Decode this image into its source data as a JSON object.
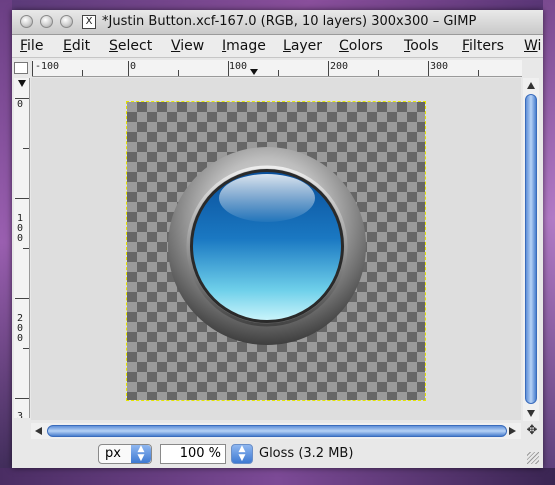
{
  "window": {
    "title": "*Justin Button.xcf-167.0 (RGB, 10 layers) 300x300 – GIMP",
    "x11_icon": "X"
  },
  "menu": [
    "File",
    "Edit",
    "Select",
    "View",
    "Image",
    "Layer",
    "Colors",
    "Tools",
    "Filters",
    "Wi"
  ],
  "rulers": {
    "horizontal": [
      "-100",
      "0",
      "100",
      "200",
      "300"
    ],
    "vertical": [
      "0",
      "100",
      "200",
      "3"
    ]
  },
  "status": {
    "unit": "px",
    "zoom": "100 %",
    "text": "Gloss (3.2 MB)"
  },
  "icons": {
    "nav": "navigate-icon",
    "combo": "up-down-arrows-icon"
  }
}
